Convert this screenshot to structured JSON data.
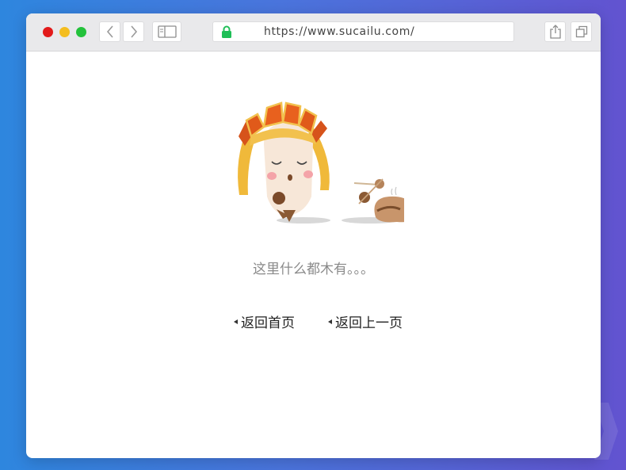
{
  "browser": {
    "url": "https://www.sucailu.com/",
    "icons": {
      "back": "chevron-left-icon",
      "forward": "chevron-right-icon",
      "sidebar": "sidebar-icon",
      "lock": "lock-icon",
      "share": "share-icon",
      "tabs": "tabs-icon"
    },
    "colors": {
      "close": "#e21a1a",
      "minimize": "#f4bd1f",
      "maximize": "#23c23b",
      "lock": "#1fbf57"
    }
  },
  "page": {
    "message": "这里什么都木有。。。",
    "links": {
      "home": "返回首页",
      "back": "返回上一页"
    }
  }
}
